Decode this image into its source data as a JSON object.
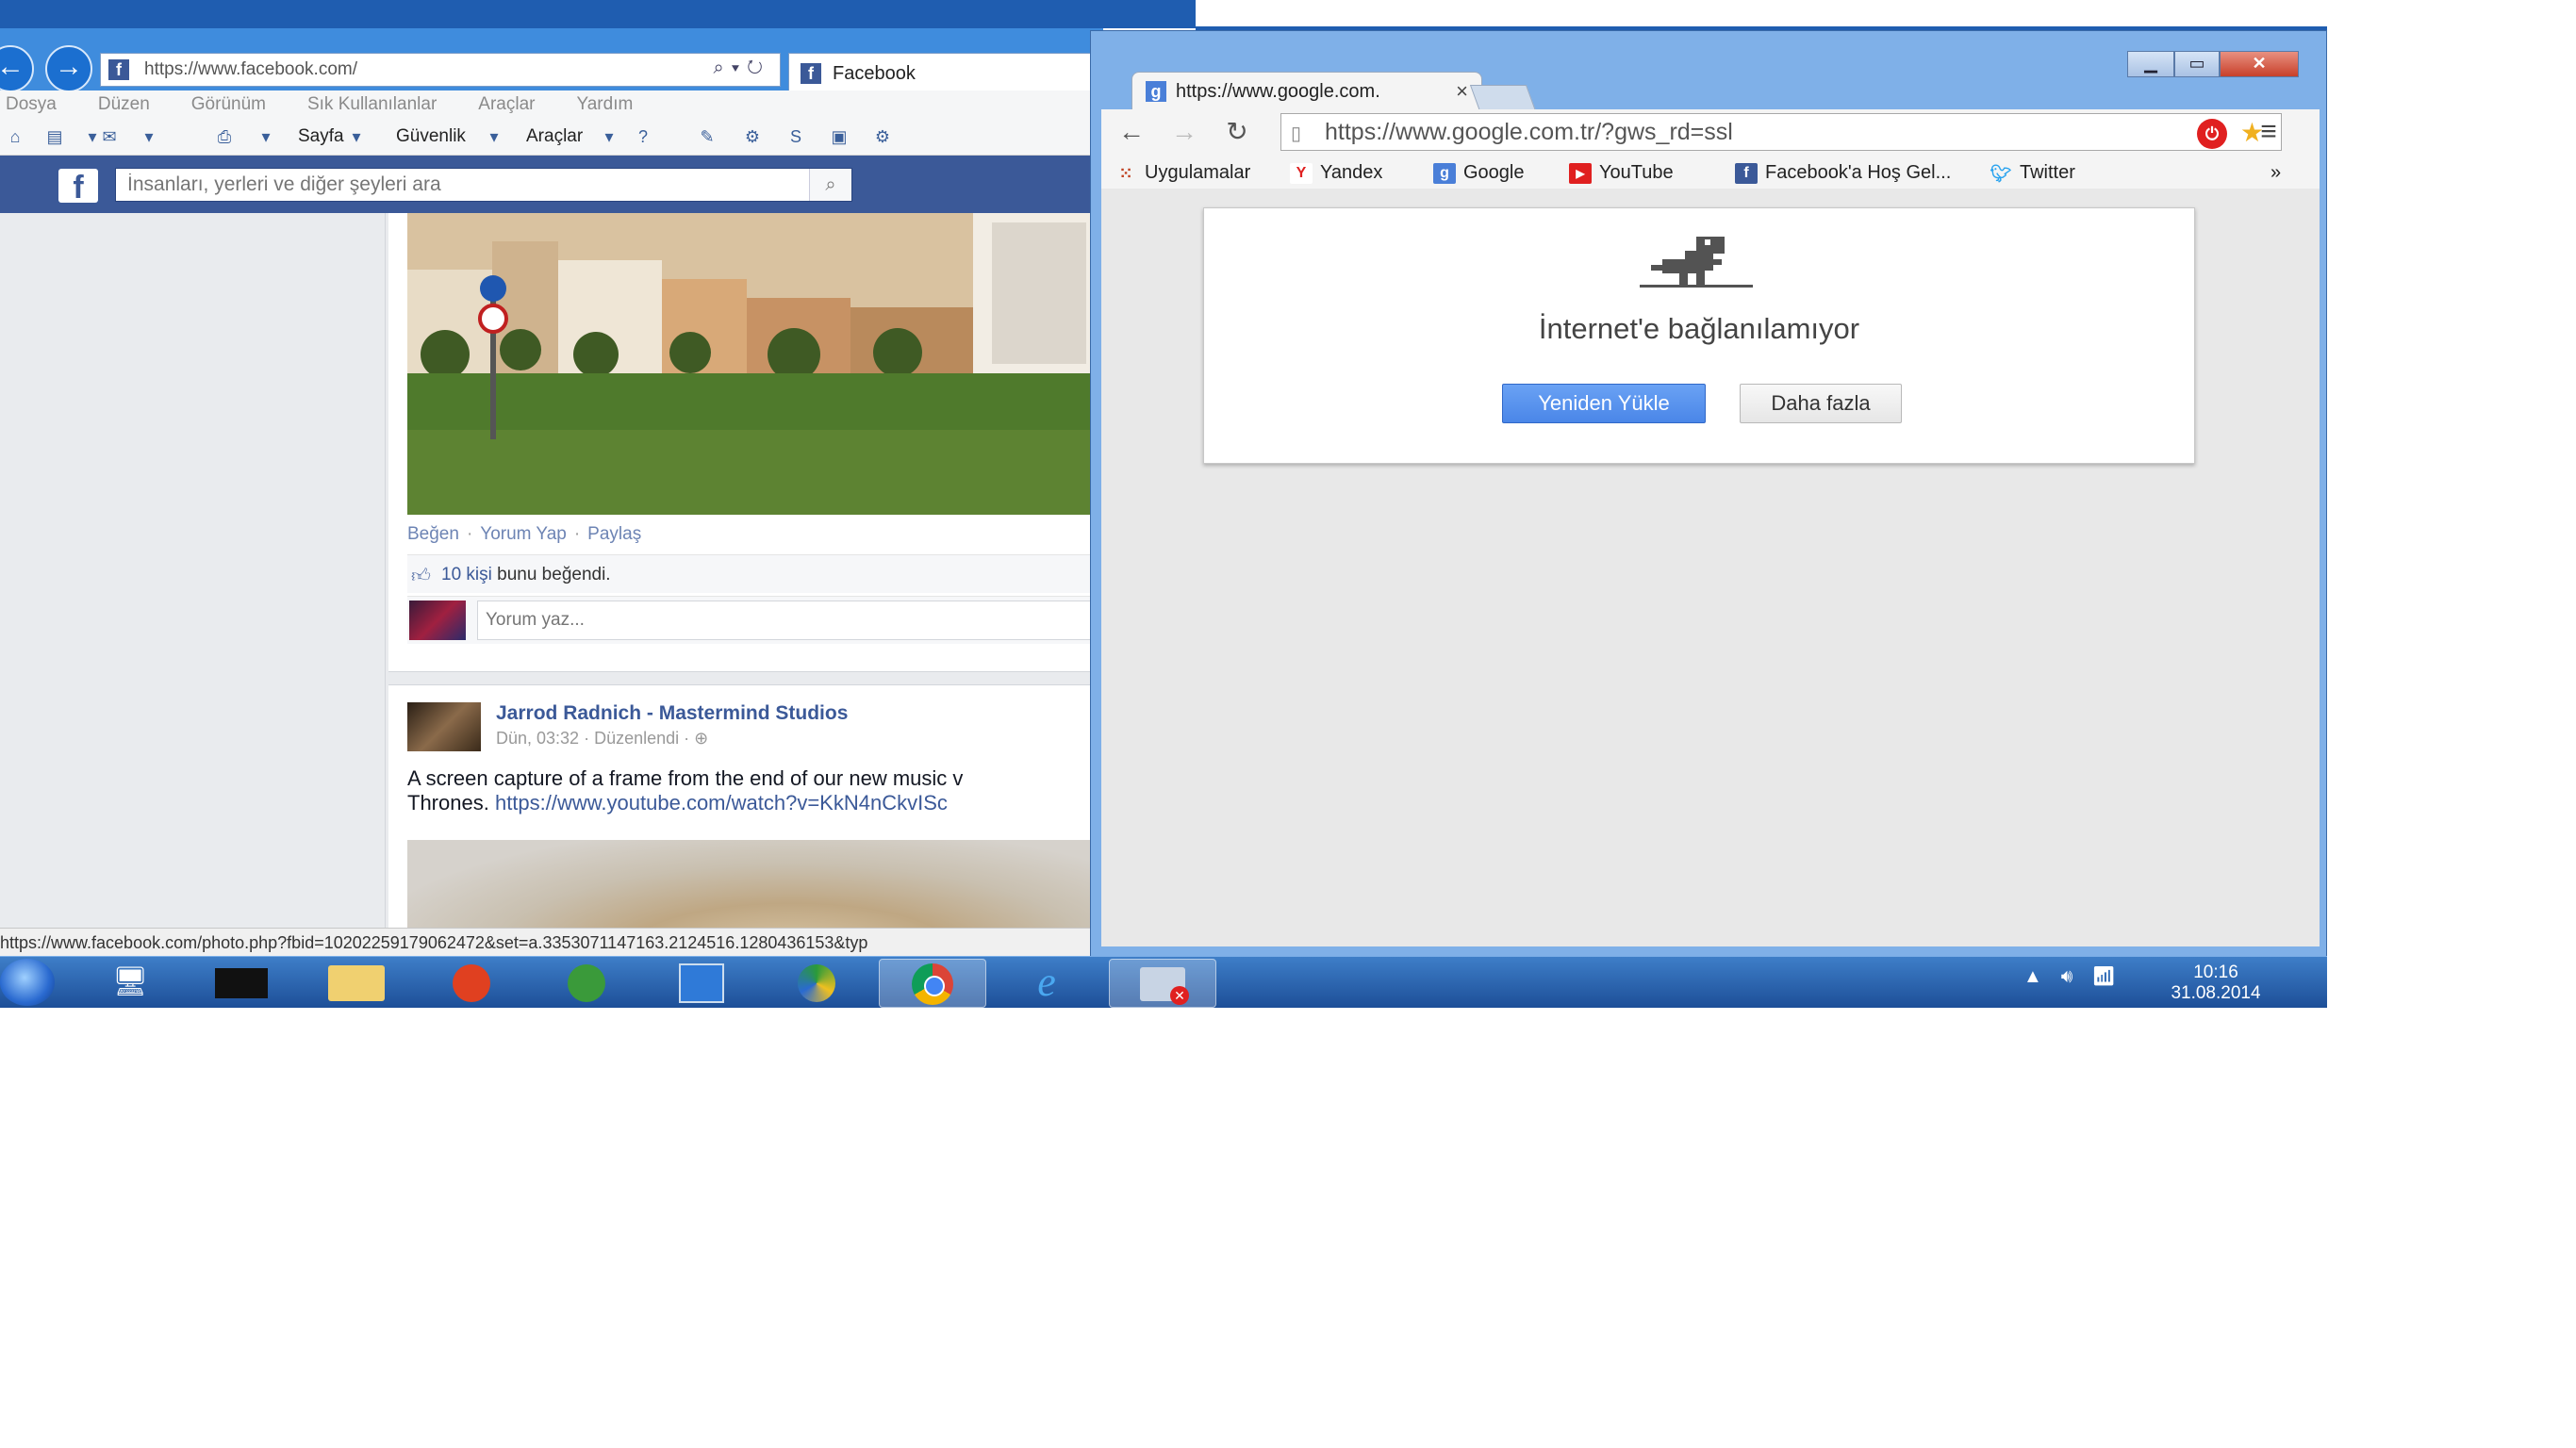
{
  "ie": {
    "address_url": "https://www.facebook.com/",
    "tab_label": "Facebook",
    "menu": [
      "Dosya",
      "Düzen",
      "Görünüm",
      "Sık Kullanılanlar",
      "Araçlar",
      "Yardım"
    ],
    "cmd": {
      "sayfa": "Sayfa",
      "guvenlik": "Güvenlik",
      "araclar": "Araçlar"
    },
    "status_url": "https://www.facebook.com/photo.php?fbid=10202259179062472&set=a.3353071147163.2124516.1280436153&typ"
  },
  "facebook": {
    "search_placeholder": "İnsanları, yerleri ve diğer şeyleri ara",
    "post1": {
      "actions": [
        "Beğen",
        "Yorum Yap",
        "Paylaş"
      ],
      "likes_count": "10 kişi",
      "likes_suffix": "bunu beğendi.",
      "comment_placeholder": "Yorum yaz..."
    },
    "post2": {
      "author": "Jarrod Radnich - Mastermind Studios",
      "time": "Dün, 03:32",
      "edited": "Düzenlendi",
      "text_line1": "A screen capture of a frame from the end of our new music v",
      "text_line2_prefix": "Thrones.",
      "link": "https://www.youtube.com/watch?v=KkN4nCkvISc"
    }
  },
  "chrome": {
    "tab_title": "https://www.google.com.",
    "omnibox_url": "https://www.google.com.tr/?gws_rd=ssl",
    "bookmarks": [
      "Uygulamalar",
      "Yandex",
      "Google",
      "YouTube",
      "Facebook'a Hoş Gel...",
      "Twitter"
    ],
    "bookmarks_overflow": "»",
    "error": {
      "title": "İnternet'e bağlanılamıyor",
      "reload_button": "Yeniden Yükle",
      "more_button": "Daha fazla"
    }
  },
  "taskbar": {
    "time": "10:16",
    "date": "31.08.2014"
  },
  "colors": {
    "facebook_blue": "#3b5998",
    "chrome_button_blue": "#4a86e8",
    "taskbar_blue": "#1d4f98"
  }
}
